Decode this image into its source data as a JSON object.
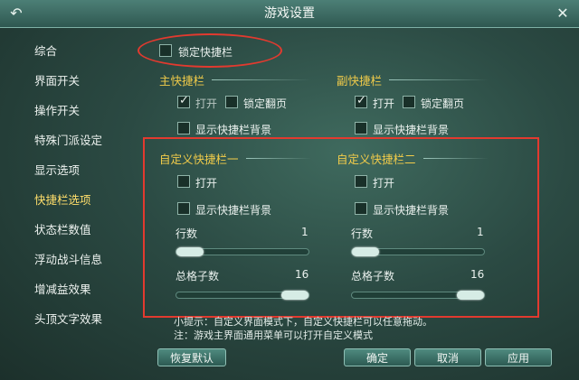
{
  "window": {
    "title": "游戏设置"
  },
  "sidebar": {
    "items": [
      {
        "label": "综合"
      },
      {
        "label": "界面开关"
      },
      {
        "label": "操作开关"
      },
      {
        "label": "特殊门派设定"
      },
      {
        "label": "显示选项"
      },
      {
        "label": "快捷栏选项"
      },
      {
        "label": "状态栏数值"
      },
      {
        "label": "浮动战斗信息"
      },
      {
        "label": "增减益效果"
      },
      {
        "label": "头顶文字效果"
      }
    ],
    "active_index": 5
  },
  "lock_bar": {
    "label": "锁定快捷栏",
    "checked": false
  },
  "main_bar": {
    "title": "主快捷栏",
    "open_label": "打开",
    "open_checked": true,
    "lock_page_label": "锁定翻页",
    "lock_page_checked": false,
    "show_bg_label": "显示快捷栏背景",
    "show_bg_checked": false
  },
  "sub_bar": {
    "title": "副快捷栏",
    "open_label": "打开",
    "open_checked": true,
    "lock_page_label": "锁定翻页",
    "lock_page_checked": false,
    "show_bg_label": "显示快捷栏背景",
    "show_bg_checked": false
  },
  "custom1": {
    "title": "自定义快捷栏一",
    "open_label": "打开",
    "open_checked": false,
    "show_bg_label": "显示快捷栏背景",
    "show_bg_checked": false,
    "rows_label": "行数",
    "rows_value": "1",
    "rows_fraction": 0.0,
    "slots_label": "总格子数",
    "slots_value": "16",
    "slots_fraction": 1.0
  },
  "custom2": {
    "title": "自定义快捷栏二",
    "open_label": "打开",
    "open_checked": false,
    "show_bg_label": "显示快捷栏背景",
    "show_bg_checked": false,
    "rows_label": "行数",
    "rows_value": "1",
    "rows_fraction": 0.0,
    "slots_label": "总格子数",
    "slots_value": "16",
    "slots_fraction": 1.0
  },
  "hints": {
    "line1": "小提示：自定义界面模式下，自定义快捷栏可以任意拖动。",
    "line2": "注：游戏主界面通用菜单可以打开自定义模式"
  },
  "buttons": {
    "restore": "恢复默认",
    "ok": "确定",
    "cancel": "取消",
    "apply": "应用"
  },
  "colors": {
    "accent_title": "#f2cc4a",
    "active_item": "#ffde6b",
    "highlight": "#e23a2f"
  }
}
